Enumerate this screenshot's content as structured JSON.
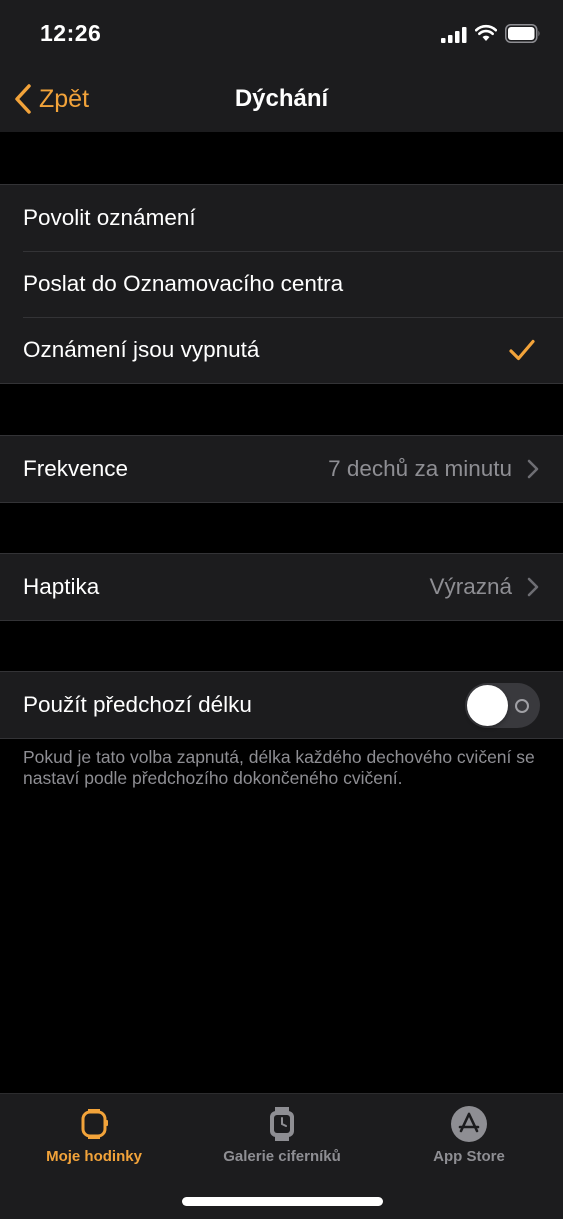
{
  "status_bar": {
    "time": "12:26"
  },
  "nav": {
    "back_label": "Zpět",
    "title": "Dýchání"
  },
  "notifications": {
    "items": [
      {
        "label": "Povolit oznámení",
        "selected": false
      },
      {
        "label": "Poslat do Oznamovacího centra",
        "selected": false
      },
      {
        "label": "Oznámení jsou vypnutá",
        "selected": true
      }
    ]
  },
  "frequency": {
    "label": "Frekvence",
    "value": "7 dechů za minutu"
  },
  "haptics": {
    "label": "Haptika",
    "value": "Výrazná"
  },
  "previous_length": {
    "label": "Použít předchozí délku",
    "enabled": false,
    "footnote": "Pokud je tato volba zapnutá, délka každého dechového cvičení se nastaví podle předchozího dokončeného cvičení."
  },
  "tab_bar": {
    "tabs": [
      {
        "label": "Moje hodinky",
        "icon": "watch-icon",
        "active": true
      },
      {
        "label": "Galerie ciferníků",
        "icon": "watch-face-gallery-icon",
        "active": false
      },
      {
        "label": "App Store",
        "icon": "app-store-icon",
        "active": false
      }
    ]
  },
  "colors": {
    "accent": "#f2a33a",
    "background": "#000000",
    "cell": "#1c1c1e",
    "secondary_text": "#8e8e93"
  }
}
